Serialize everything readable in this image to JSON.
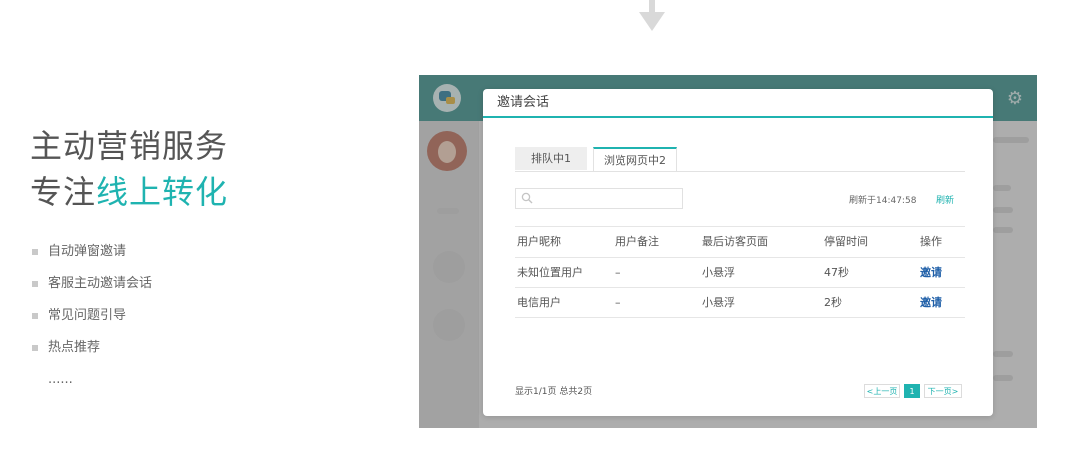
{
  "intro": {
    "title_line1": "主动营销服务",
    "title_line2_prefix": "专注",
    "title_line2_accent": "线上转化",
    "features": [
      "自动弹窗邀请",
      "客服主动邀请会话",
      "常见问题引导",
      "热点推荐"
    ],
    "more": "......"
  },
  "modal": {
    "title": "邀请会话",
    "tabs": [
      {
        "label": "排队中1"
      },
      {
        "label": "浏览网页中2"
      }
    ],
    "search": {
      "placeholder": "",
      "icon": "search-icon"
    },
    "refresh_time": "刷新于14:47:58",
    "refresh_label": "刷新",
    "table": {
      "headers": [
        "用户昵称",
        "用户备注",
        "最后访客页面",
        "停留时间",
        "操作"
      ],
      "rows": [
        [
          "未知位置用户",
          "–",
          "小悬浮",
          "47秒",
          "邀请"
        ],
        [
          "电信用户",
          "–",
          "小悬浮",
          "2秒",
          "邀请"
        ]
      ]
    },
    "footer_info": "显示1/1页 总共2页",
    "pagination": {
      "prev": "<上一页",
      "current": "1",
      "next": "下一页>"
    }
  },
  "colors": {
    "accent": "#1fb3b0",
    "app_bar": "#3a8f8b",
    "link": "#1f5fa8"
  }
}
